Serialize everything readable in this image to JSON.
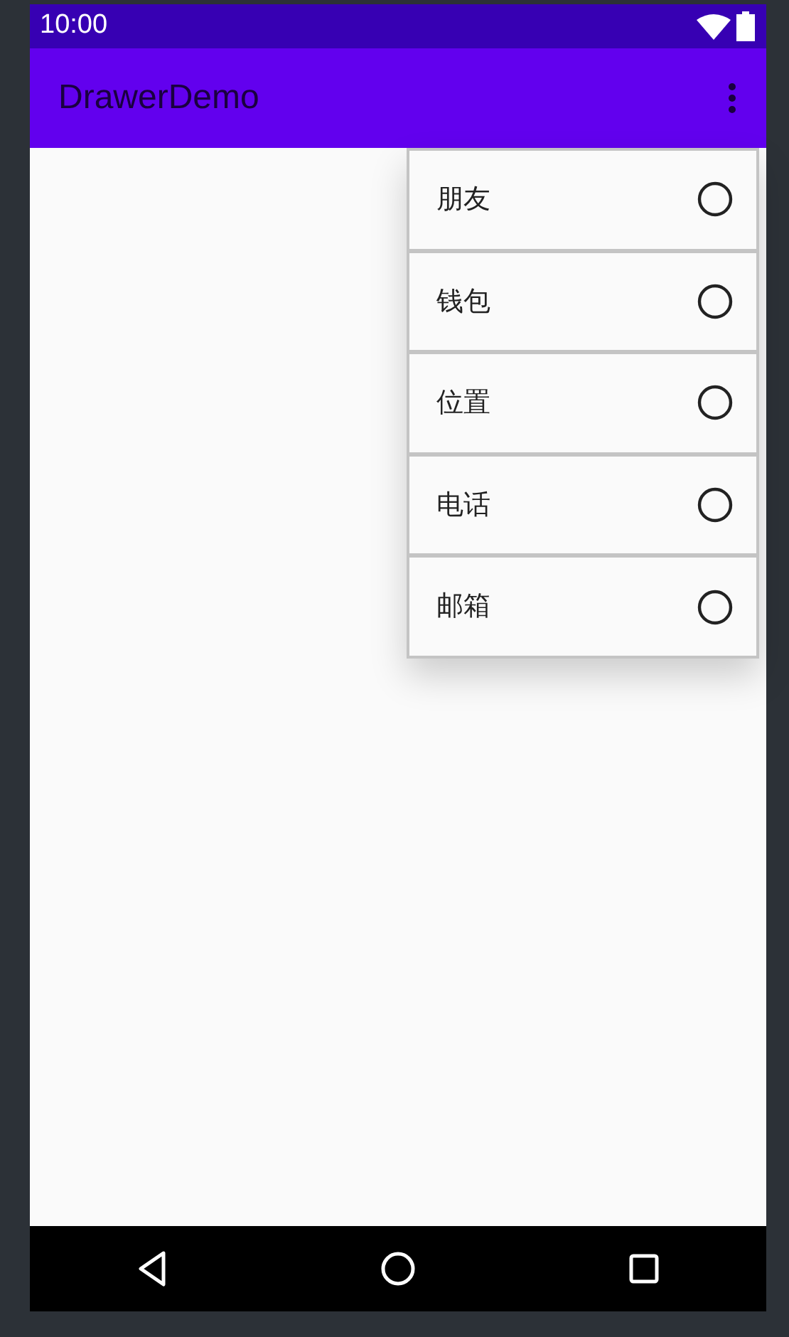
{
  "status_bar": {
    "time": "10:00"
  },
  "app_bar": {
    "title": "DrawerDemo"
  },
  "menu": {
    "items": [
      {
        "label": "朋友",
        "checked": false
      },
      {
        "label": "钱包",
        "checked": false
      },
      {
        "label": "位置",
        "checked": false
      },
      {
        "label": "电话",
        "checked": false
      },
      {
        "label": "邮箱",
        "checked": false
      }
    ]
  }
}
